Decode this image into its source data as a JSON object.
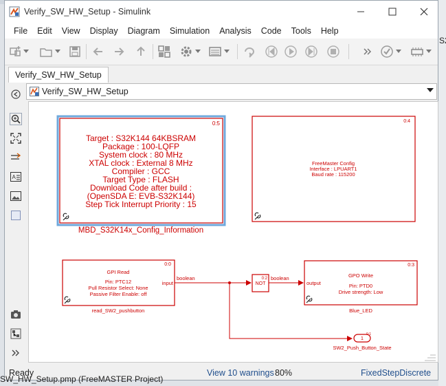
{
  "window": {
    "title": "Verify_SW_HW_Setup - Simulink",
    "controls": {
      "minimize": "minimize",
      "maximize": "maximize",
      "close": "close"
    }
  },
  "menu": [
    "File",
    "Edit",
    "View",
    "Display",
    "Diagram",
    "Simulation",
    "Analysis",
    "Code",
    "Tools",
    "Help"
  ],
  "tab": {
    "label": "Verify_SW_HW_Setup"
  },
  "address": {
    "path": "Verify_SW_HW_Setup"
  },
  "background": {
    "right_edge_text": "S2",
    "bottom_file": "SW_HW_Setup.pmp (FreeMASTER Project)"
  },
  "canvas": {
    "config_block": {
      "id": "0:5",
      "lines": [
        "Target : S32K144 64KBSRAM",
        "Package : 100-LQFP",
        "System clock : 80 MHz",
        "XTAL clock : External 8 MHz",
        "Compiler : GCC",
        "Target Type : FLASH",
        "Download Code after build :",
        "(OpenSDA E: EVB-S32K144)",
        "Step Tick Interrupt Priority : 15"
      ],
      "name": "MBD_S32K14x_Config_Information"
    },
    "freemaster_block": {
      "id": "0:4",
      "lines": [
        "FreeMaster Config",
        "Interface : LPUART1",
        "Baud rate : 115200"
      ]
    },
    "gpi_block": {
      "id": "0:0",
      "title": "GPI Read",
      "lines": [
        "Pin: PTC12",
        "Pull Resistor Select: None",
        "Passive Filter Enable: off"
      ],
      "port": "input",
      "name": "read_SW2_pushbutton"
    },
    "not_block": {
      "id": "0:2",
      "label": "NOT"
    },
    "gpo_block": {
      "id": "0:3",
      "title": "GPO Write",
      "lines": [
        "Pin: PTD0",
        "Drive strength: Low"
      ],
      "port": "output",
      "name": "Blue_LED"
    },
    "outport": {
      "number": "1",
      "id": "0:1",
      "name": "SW2_Push_Button_State"
    },
    "signal_labels": {
      "gpi_to_not": "boolean",
      "not_to_gpo": "boolean"
    }
  },
  "status": {
    "ready": "Ready",
    "warnings": "View 10 warnings",
    "zoom": "80%",
    "solver": "FixedStepDiscrete"
  }
}
